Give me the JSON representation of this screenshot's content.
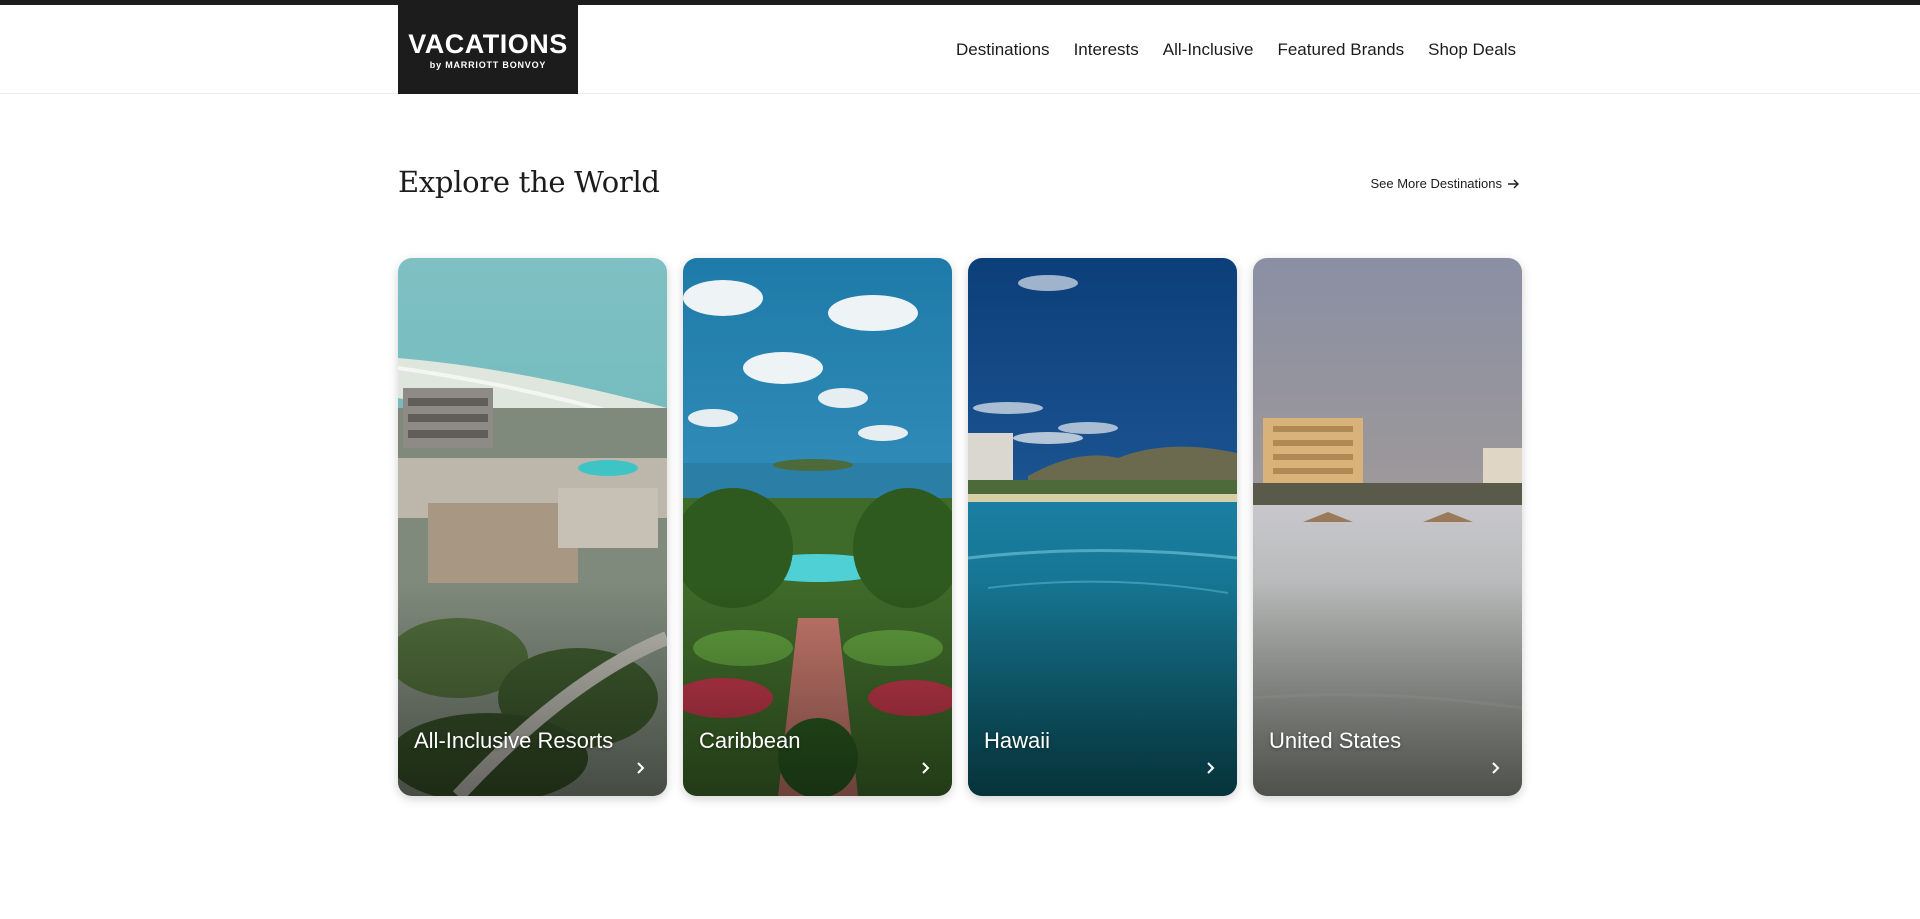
{
  "brand": {
    "name": "VACATIONS",
    "tagline": "by MARRIOTT BONVOY"
  },
  "nav": {
    "items": [
      {
        "label": "Destinations"
      },
      {
        "label": "Interests"
      },
      {
        "label": "All-Inclusive"
      },
      {
        "label": "Featured Brands"
      },
      {
        "label": "Shop Deals"
      }
    ]
  },
  "section": {
    "title": "Explore the World",
    "see_more": "See More Destinations",
    "see_more_icon": "arrow-right-icon"
  },
  "cards": [
    {
      "label": "All-Inclusive Resorts",
      "icon": "chevron-right-icon"
    },
    {
      "label": "Caribbean",
      "icon": "chevron-right-icon"
    },
    {
      "label": "Hawaii",
      "icon": "chevron-right-icon"
    },
    {
      "label": "United States",
      "icon": "chevron-right-icon"
    }
  ],
  "colors": {
    "dark": "#1c1c1c",
    "background": "#ffffff",
    "card_text": "#ffffff"
  }
}
